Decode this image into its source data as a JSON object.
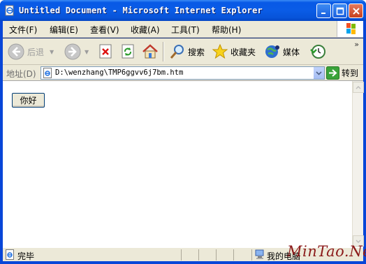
{
  "window": {
    "title": "Untitled Document - Microsoft Internet Explorer"
  },
  "menu": {
    "items": [
      "文件(F)",
      "编辑(E)",
      "查看(V)",
      "收藏(A)",
      "工具(T)",
      "帮助(H)"
    ]
  },
  "toolbar": {
    "back_label": "后退",
    "search_label": "搜索",
    "favorites_label": "收藏夹",
    "media_label": "媒体"
  },
  "address": {
    "label": "地址(D)",
    "url": "D:\\wenzhang\\TMP6ggvv6j7bm.htm",
    "go_label": "转到"
  },
  "page": {
    "button_label": "你好"
  },
  "status": {
    "text": "完毕",
    "zone": "我的电脑"
  },
  "watermark": "MinTao.Net",
  "colors": {
    "titlebar": "#0a5ce6",
    "chrome": "#ece9d8",
    "close_button": "#c6401e"
  }
}
